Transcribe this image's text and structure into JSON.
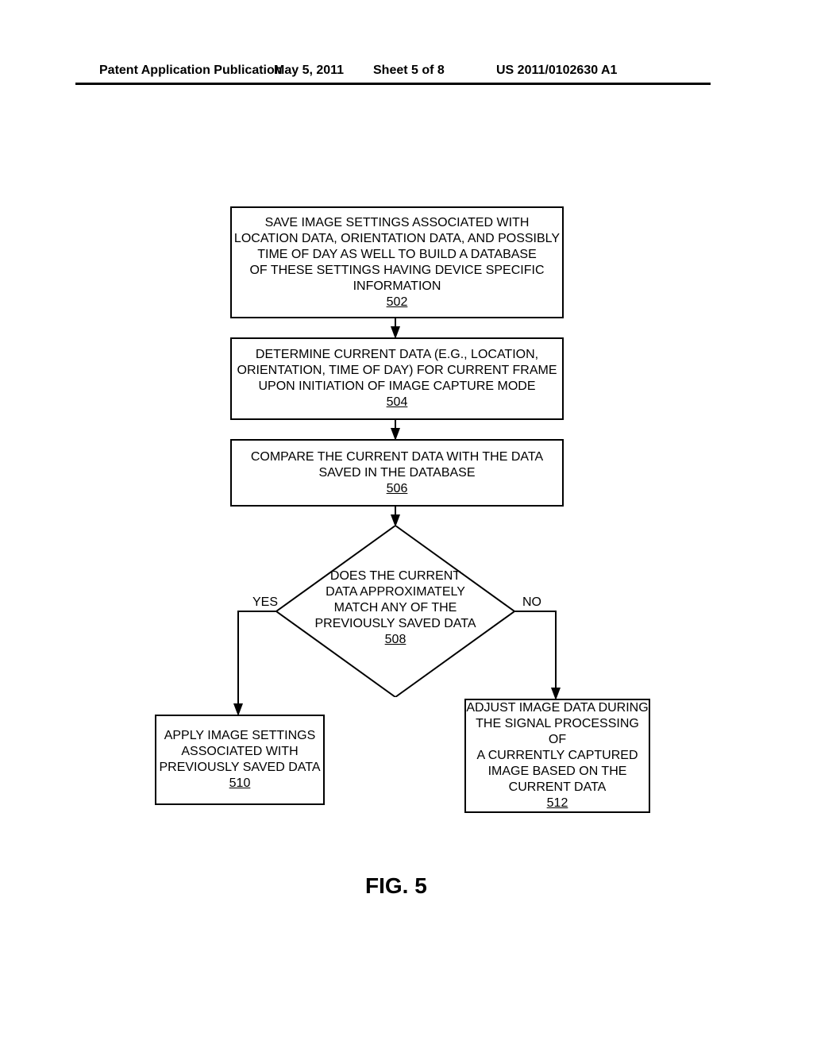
{
  "header": {
    "left": "Patent Application Publication",
    "date": "May 5, 2011",
    "sheet": "Sheet 5 of 8",
    "pubno": "US 2011/0102630 A1"
  },
  "boxes": {
    "b502": {
      "lines": [
        "SAVE IMAGE SETTINGS ASSOCIATED WITH",
        "LOCATION DATA, ORIENTATION DATA, AND POSSIBLY",
        "TIME OF DAY AS WELL TO BUILD A DATABASE",
        "OF THESE SETTINGS HAVING DEVICE SPECIFIC",
        "INFORMATION"
      ],
      "ref": "502"
    },
    "b504": {
      "lines": [
        "DETERMINE CURRENT DATA (E.G., LOCATION,",
        "ORIENTATION, TIME OF DAY) FOR CURRENT FRAME",
        "UPON INITIATION OF IMAGE CAPTURE MODE"
      ],
      "ref": "504"
    },
    "b506": {
      "lines": [
        "COMPARE THE CURRENT DATA WITH THE DATA",
        "SAVED IN THE DATABASE"
      ],
      "ref": "506"
    },
    "d508": {
      "lines": [
        "DOES THE CURRENT",
        "DATA APPROXIMATELY",
        "MATCH ANY OF THE",
        "PREVIOUSLY SAVED DATA"
      ],
      "ref": "508"
    },
    "b510": {
      "lines": [
        "APPLY IMAGE SETTINGS",
        "ASSOCIATED WITH",
        "PREVIOUSLY SAVED DATA"
      ],
      "ref": "510"
    },
    "b512": {
      "lines": [
        "ADJUST IMAGE DATA DURING",
        "THE SIGNAL PROCESSING OF",
        "A CURRENTLY CAPTURED",
        "IMAGE BASED ON THE",
        "CURRENT DATA"
      ],
      "ref": "512"
    }
  },
  "labels": {
    "yes": "YES",
    "no": "NO",
    "figure": "FIG. 5"
  }
}
